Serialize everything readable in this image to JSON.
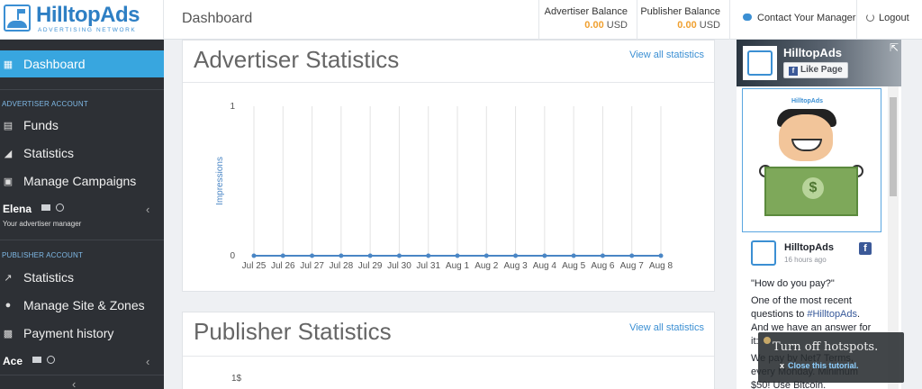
{
  "brand": {
    "name": "HilltopAds",
    "tagline": "ADVERTISING NETWORK"
  },
  "header": {
    "title": "Dashboard",
    "advertiser_balance": {
      "label": "Advertiser Balance",
      "amount": "0.00",
      "currency": "USD"
    },
    "publisher_balance": {
      "label": "Publisher Balance",
      "amount": "0.00",
      "currency": "USD"
    },
    "contact_label": "Contact Your Manager",
    "logout_label": "Logout"
  },
  "sidebar": {
    "dashboard": "Dashboard",
    "advertiser_section": "ADVERTISER ACCOUNT",
    "advertiser_items": [
      "Funds",
      "Statistics",
      "Manage Campaigns"
    ],
    "advertiser_manager": {
      "name": "Elena",
      "subtitle": "Your advertiser manager"
    },
    "publisher_section": "PUBLISHER ACCOUNT",
    "publisher_items": [
      "Statistics",
      "Manage Site & Zones",
      "Payment history"
    ],
    "publisher_manager": {
      "name": "Ace"
    }
  },
  "advertiser_stats": {
    "title": "Advertiser Statistics",
    "link": "View all statistics"
  },
  "publisher_stats": {
    "title": "Publisher Statistics",
    "link": "View all statistics",
    "first_tick": "1$"
  },
  "chart_data": {
    "type": "line",
    "title": "",
    "xlabel": "",
    "ylabel": "Impressions",
    "ylim": [
      0,
      1
    ],
    "yticks": [
      "1",
      "0"
    ],
    "categories": [
      "Jul 25",
      "Jul 26",
      "Jul 27",
      "Jul 28",
      "Jul 29",
      "Jul 30",
      "Jul 31",
      "Aug 1",
      "Aug 2",
      "Aug 3",
      "Aug 4",
      "Aug 5",
      "Aug 6",
      "Aug 7",
      "Aug 8"
    ],
    "series": [
      {
        "values": [
          0,
          0,
          0,
          0,
          0,
          0,
          0,
          0,
          0,
          0,
          0,
          0,
          0,
          0,
          0
        ]
      }
    ],
    "grid": true,
    "color": "#4a86c5"
  },
  "facebook": {
    "page_name": "HilltopAds",
    "like_label": "Like Page",
    "promo_brand": "HilltopAds",
    "post": {
      "author": "HilltopAds",
      "time": "16 hours ago",
      "quote": "\"How do you pay?\"",
      "body_pre": "One of the most recent questions to ",
      "hashtag": "#HilltopAds",
      "body_post": ". And we have an answer for it:",
      "more": "We pay by Net7 Terms, every Monday. Minimum $50! Use Bitcoin."
    }
  },
  "tutorial": {
    "title": "Turn off hotspots.",
    "close": "Close this tutorial."
  }
}
